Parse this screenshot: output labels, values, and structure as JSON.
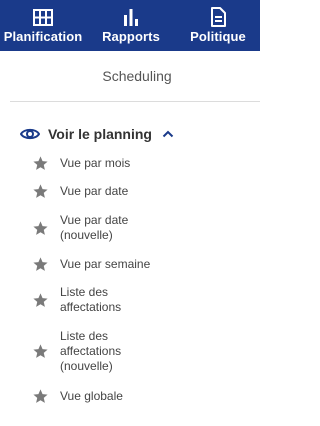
{
  "topnav": {
    "items": [
      {
        "label": "Planification",
        "icon": "grid-icon"
      },
      {
        "label": "Rapports",
        "icon": "bar-chart-icon"
      },
      {
        "label": "Politique",
        "icon": "document-icon"
      }
    ]
  },
  "page": {
    "subtitle": "Scheduling"
  },
  "section": {
    "label": "Voir le planning",
    "icon": "eye-icon",
    "toggle_icon": "chevron-up-icon",
    "items": [
      {
        "label": "Vue par mois",
        "icon": "star-icon"
      },
      {
        "label": "Vue par date",
        "icon": "star-icon"
      },
      {
        "label": "Vue par date (nouvelle)",
        "icon": "star-icon"
      },
      {
        "label": "Vue par semaine",
        "icon": "star-icon"
      },
      {
        "label": "Liste des affectations",
        "icon": "star-icon"
      },
      {
        "label": "Liste des affectations (nouvelle)",
        "icon": "star-icon"
      },
      {
        "label": "Vue globale",
        "icon": "star-icon"
      }
    ]
  },
  "colors": {
    "topbar": "#1a3a8a",
    "accent": "#1a3a8a",
    "star": "#7a7a7a"
  }
}
